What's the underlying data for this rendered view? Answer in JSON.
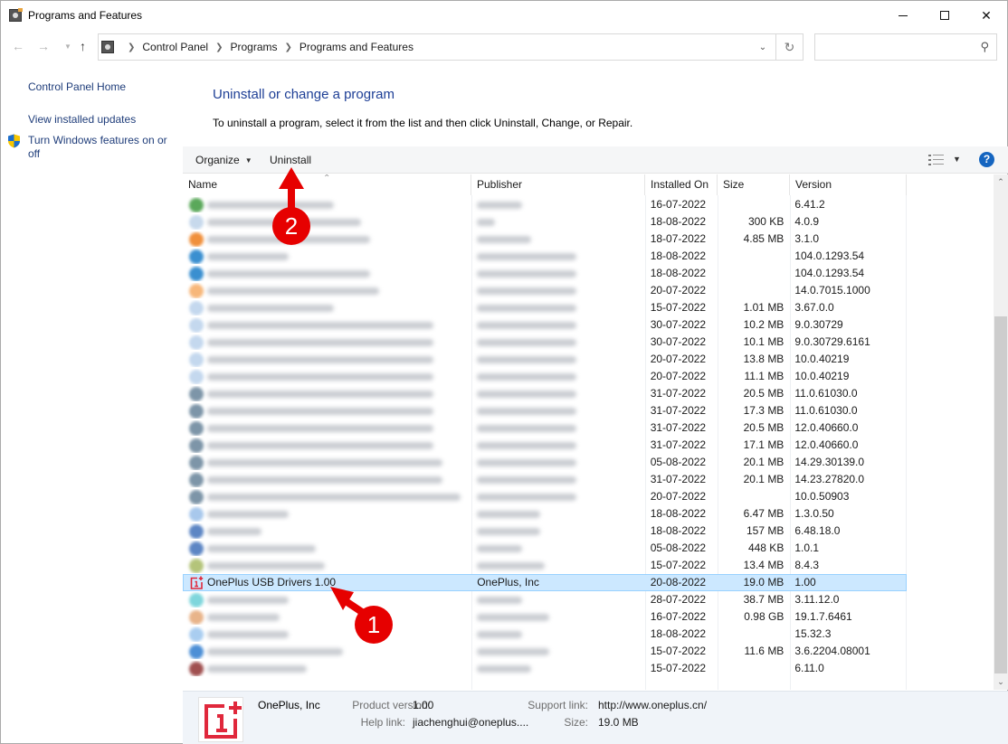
{
  "window": {
    "title": "Programs and Features",
    "icon": "programs-and-features-icon",
    "controls": {
      "minimize": "minimize",
      "maximize": "maximize",
      "close": "✕"
    }
  },
  "addressbar": {
    "breadcrumbs": [
      "Control Panel",
      "Programs",
      "Programs and Features"
    ],
    "search_placeholder": ""
  },
  "sidebar": {
    "links": [
      {
        "label": "Control Panel Home"
      },
      {
        "label": "View installed updates"
      },
      {
        "label": "Turn Windows features on or off",
        "icon": "shield-icon"
      }
    ]
  },
  "main": {
    "heading": "Uninstall or change a program",
    "description": "To uninstall a program, select it from the list and then click Uninstall, Change, or Repair."
  },
  "toolbar": {
    "organize_label": "Organize",
    "uninstall_label": "Uninstall"
  },
  "list": {
    "columns": [
      "Name",
      "Publisher",
      "Installed On",
      "Size",
      "Version"
    ],
    "rows": [
      {
        "name": null,
        "publisher": null,
        "installed_on": "16-07-2022",
        "size": "",
        "version": "6.41.2",
        "icon_color": "#5aa85a"
      },
      {
        "name": null,
        "publisher": null,
        "installed_on": "18-08-2022",
        "size": "300 KB",
        "version": "4.0.9",
        "icon_color": "#c7d9ec"
      },
      {
        "name": null,
        "publisher": null,
        "installed_on": "18-07-2022",
        "size": "4.85 MB",
        "version": "3.1.0",
        "icon_color": "#f0903c"
      },
      {
        "name": null,
        "publisher": null,
        "installed_on": "18-08-2022",
        "size": "",
        "version": "104.0.1293.54",
        "icon_color": "#3a8fd0"
      },
      {
        "name": null,
        "publisher": null,
        "installed_on": "18-08-2022",
        "size": "",
        "version": "104.0.1293.54",
        "icon_color": "#3a8fd0"
      },
      {
        "name": null,
        "publisher": null,
        "installed_on": "20-07-2022",
        "size": "",
        "version": "14.0.7015.1000",
        "icon_color": "#f7b77a"
      },
      {
        "name": null,
        "publisher": null,
        "installed_on": "15-07-2022",
        "size": "1.01 MB",
        "version": "3.67.0.0",
        "icon_color": "#c4d8ee"
      },
      {
        "name": null,
        "publisher": null,
        "installed_on": "30-07-2022",
        "size": "10.2 MB",
        "version": "9.0.30729",
        "icon_color": "#c4d8ee"
      },
      {
        "name": null,
        "publisher": null,
        "installed_on": "30-07-2022",
        "size": "10.1 MB",
        "version": "9.0.30729.6161",
        "icon_color": "#c4d8ee"
      },
      {
        "name": null,
        "publisher": null,
        "installed_on": "20-07-2022",
        "size": "13.8 MB",
        "version": "10.0.40219",
        "icon_color": "#c4d8ee"
      },
      {
        "name": null,
        "publisher": null,
        "installed_on": "20-07-2022",
        "size": "11.1 MB",
        "version": "10.0.40219",
        "icon_color": "#c4d8ee"
      },
      {
        "name": null,
        "publisher": null,
        "installed_on": "31-07-2022",
        "size": "20.5 MB",
        "version": "11.0.61030.0",
        "icon_color": "#7d95a8"
      },
      {
        "name": null,
        "publisher": null,
        "installed_on": "31-07-2022",
        "size": "17.3 MB",
        "version": "11.0.61030.0",
        "icon_color": "#7d95a8"
      },
      {
        "name": null,
        "publisher": null,
        "installed_on": "31-07-2022",
        "size": "20.5 MB",
        "version": "12.0.40660.0",
        "icon_color": "#7d95a8"
      },
      {
        "name": null,
        "publisher": null,
        "installed_on": "31-07-2022",
        "size": "17.1 MB",
        "version": "12.0.40660.0",
        "icon_color": "#7d95a8"
      },
      {
        "name": null,
        "publisher": null,
        "installed_on": "05-08-2022",
        "size": "20.1 MB",
        "version": "14.29.30139.0",
        "icon_color": "#7d95a8"
      },
      {
        "name": null,
        "publisher": null,
        "installed_on": "31-07-2022",
        "size": "20.1 MB",
        "version": "14.23.27820.0",
        "icon_color": "#7d95a8"
      },
      {
        "name": null,
        "publisher": null,
        "installed_on": "20-07-2022",
        "size": "",
        "version": "10.0.50903",
        "icon_color": "#7d95a8"
      },
      {
        "name": null,
        "publisher": null,
        "installed_on": "18-08-2022",
        "size": "6.47 MB",
        "version": "1.3.0.50",
        "icon_color": "#a8c8ec"
      },
      {
        "name": null,
        "publisher": null,
        "installed_on": "18-08-2022",
        "size": "157 MB",
        "version": "6.48.18.0",
        "icon_color": "#5d86c4"
      },
      {
        "name": null,
        "publisher": null,
        "installed_on": "05-08-2022",
        "size": "448 KB",
        "version": "1.0.1",
        "icon_color": "#5d86c4"
      },
      {
        "name": null,
        "publisher": null,
        "installed_on": "15-07-2022",
        "size": "13.4 MB",
        "version": "8.4.3",
        "icon_color": "#b4c47a"
      },
      {
        "name": "OnePlus USB Drivers 1.00",
        "publisher": "OnePlus, Inc",
        "installed_on": "20-08-2022",
        "size": "19.0 MB",
        "version": "1.00",
        "icon_color": "#e0283c",
        "selected": true
      },
      {
        "name": null,
        "publisher": null,
        "installed_on": "28-07-2022",
        "size": "38.7 MB",
        "version": "3.11.12.0",
        "icon_color": "#7fd6dc"
      },
      {
        "name": null,
        "publisher": null,
        "installed_on": "16-07-2022",
        "size": "0.98 GB",
        "version": "19.1.7.6461",
        "icon_color": "#e8b48a"
      },
      {
        "name": null,
        "publisher": null,
        "installed_on": "18-08-2022",
        "size": "",
        "version": "15.32.3",
        "icon_color": "#a9cdf0"
      },
      {
        "name": null,
        "publisher": null,
        "installed_on": "15-07-2022",
        "size": "11.6 MB",
        "version": "3.6.2204.08001",
        "icon_color": "#4c8fd6"
      },
      {
        "name": null,
        "publisher": null,
        "installed_on": "15-07-2022",
        "size": "",
        "version": "6.11.0",
        "icon_color": "#a05050"
      }
    ]
  },
  "details": {
    "company": "OnePlus, Inc",
    "product_version_label": "Product version:",
    "product_version": "1.00",
    "help_link_label": "Help link:",
    "help_link": "jiachenghui@oneplus....",
    "support_link_label": "Support link:",
    "support_link": "http://www.oneplus.cn/",
    "size_label": "Size:",
    "size": "19.0 MB"
  },
  "annotations": [
    {
      "number": "1",
      "target": "OnePlus USB Drivers 1.00 row",
      "color": "#e60000"
    },
    {
      "number": "2",
      "target": "Uninstall button",
      "color": "#e60000"
    }
  ]
}
